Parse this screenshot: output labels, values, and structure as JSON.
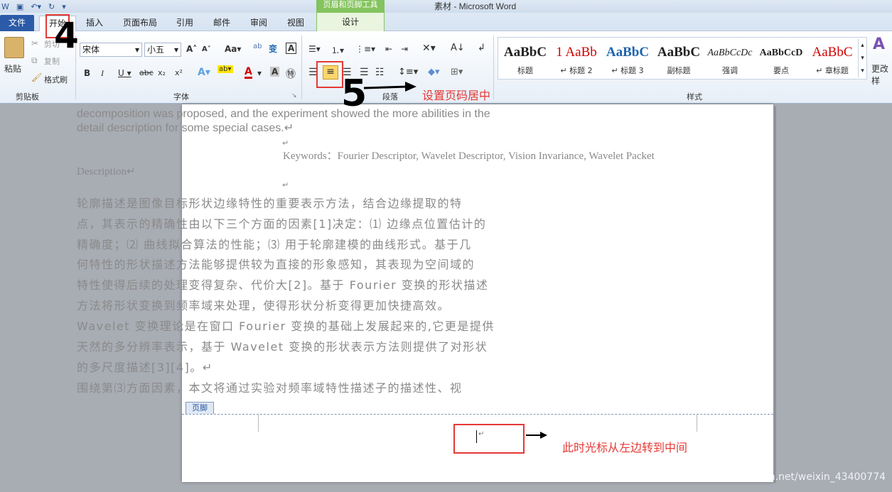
{
  "window": {
    "title": "素材 - Microsoft Word",
    "context_tab_title": "页眉和页脚工具"
  },
  "tabs": [
    "文件",
    "开始",
    "插入",
    "页面布局",
    "引用",
    "邮件",
    "审阅",
    "视图",
    "设计"
  ],
  "clipboard": {
    "paste": "粘贴",
    "cut": "剪切",
    "copy": "复制",
    "format_painter": "格式刷",
    "group": "剪贴板"
  },
  "font": {
    "name": "宋体",
    "size": "小五",
    "group": "字体"
  },
  "paragraph": {
    "group": "段落"
  },
  "styles": {
    "group": "样式",
    "items": [
      {
        "sample": "AaBbC",
        "label": "标题",
        "color": "#000000"
      },
      {
        "sample": "1 AaBb",
        "label": "↵ 标题 2",
        "color": "#d00000"
      },
      {
        "sample": "AaBbC",
        "label": "↵ 标题 3",
        "color": "#1d64b0"
      },
      {
        "sample": "AaBbC",
        "label": "副标题",
        "color": "#000000"
      },
      {
        "sample": "AaBbCcDc",
        "label": "强调",
        "color": "#000000"
      },
      {
        "sample": "AaBbCcD",
        "label": "要点",
        "color": "#000000"
      },
      {
        "sample": "AaBbC",
        "label": "↵ 章标题",
        "color": "#d00000"
      }
    ],
    "change": "更改样"
  },
  "document": {
    "line1": "decomposition was proposed, and the experiment showed the more abilities in the",
    "line2": "detail description for some special cases.↵",
    "mark1": "↵",
    "keywords1": "Keywords：Fourier Descriptor, Wavelet Descriptor, Vision Invariance, Wavelet Packet",
    "keywords2": "Description↵",
    "mark2": "↵",
    "zh_lines": [
      "   轮廓描述是图像目标形状边缘特性的重要表示方法，结合边缘提取的特",
      "点，其表示的精确性由以下三个方面的因素[1]决定：⑴ 边缘点位置估计的",
      "精确度；⑵ 曲线拟合算法的性能；⑶ 用于轮廓建模的曲线形式。基于几",
      "何特性的形状描述方法能够提供较为直接的形象感知，其表现为空间域的",
      "特性使得后续的处理变得复杂、代价大[2]。基于 Fourier 变换的形状描述",
      "方法将形状变换到频率域来处理，使得形状分析变得更加快捷高效。",
      "Wavelet 变换理论是在窗口 Fourier 变换的基础上发展起来的,它更是提供",
      "天然的多分辨率表示，基于 Wavelet 变换的形状表示方法则提供了对形状",
      "的多尺度描述[3][4]。↵",
      "   围绕第⑶方面因素，本文将通过实验对频率域特性描述子的描述性、视"
    ],
    "footer_tag": "页脚",
    "cursor_mark": "↵"
  },
  "annotations": {
    "step4": "4",
    "step5": "5",
    "center_note": "设置页码居中",
    "cursor_note": "此时光标从左边转到中间"
  },
  "watermark": "https://blog.csdn.net/weixin_43400774"
}
